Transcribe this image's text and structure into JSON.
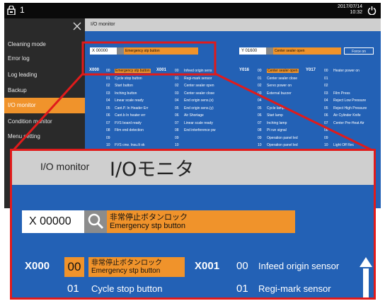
{
  "status_bar": {
    "machine_number": "1",
    "date": "2017/07/14",
    "time": "10:32"
  },
  "sidebar": {
    "items": [
      {
        "label": "Cleaning mode",
        "active": false
      },
      {
        "label": "Error log",
        "active": false
      },
      {
        "label": "Log leading",
        "active": false
      },
      {
        "label": "Backup",
        "active": false
      },
      {
        "label": "I/O monitor",
        "active": true
      },
      {
        "label": "Condition monitor",
        "active": false
      },
      {
        "label": "Menu setting",
        "active": false
      }
    ]
  },
  "io_monitor": {
    "header": "I/O monitor",
    "x_search": {
      "value": "X 00000",
      "label": "Emergency stp button"
    },
    "y_search": {
      "value": "Y 01600",
      "label": "Center sealer open",
      "force_button": "Force on"
    },
    "x_col1": {
      "address": "X000",
      "rows": [
        {
          "num": "00",
          "label": "Emergency stp button"
        },
        {
          "num": "01",
          "label": "Cycle stop button"
        },
        {
          "num": "02",
          "label": "Start button"
        },
        {
          "num": "03",
          "label": "Inching button"
        },
        {
          "num": "04",
          "label": "Linear scale ready"
        },
        {
          "num": "05",
          "label": "Cant.P. In Header Err"
        },
        {
          "num": "06",
          "label": "Cant.b In heater err"
        },
        {
          "num": "07",
          "label": "FVS board ready"
        },
        {
          "num": "08",
          "label": "Film end detection"
        },
        {
          "num": "09",
          "label": ""
        },
        {
          "num": "10",
          "label": "FVS cnw. Insu.lt ok"
        }
      ]
    },
    "x_col2": {
      "address": "X001",
      "rows": [
        {
          "num": "00",
          "label": "Infeed origin sens"
        },
        {
          "num": "01",
          "label": "Regi-mark sensor"
        },
        {
          "num": "02",
          "label": "Center sealer open"
        },
        {
          "num": "03",
          "label": "Center sealer close"
        },
        {
          "num": "04",
          "label": "End origin sens.(x)"
        },
        {
          "num": "05",
          "label": "End origin sens.(y)"
        },
        {
          "num": "06",
          "label": "Air Shortage"
        },
        {
          "num": "07",
          "label": "Linear scale ready"
        },
        {
          "num": "08",
          "label": "End interference pw"
        },
        {
          "num": "09",
          "label": ""
        },
        {
          "num": "10",
          "label": ""
        }
      ]
    },
    "y_col1": {
      "address": "Y016",
      "rows": [
        {
          "num": "00",
          "label": "Center sealer open"
        },
        {
          "num": "01",
          "label": "Center sealer close"
        },
        {
          "num": "02",
          "label": "Servo power on"
        },
        {
          "num": "03",
          "label": "External buzzer"
        },
        {
          "num": "04",
          "label": ""
        },
        {
          "num": "05",
          "label": "Cycle lamp"
        },
        {
          "num": "06",
          "label": "Start lamp"
        },
        {
          "num": "07",
          "label": "Inching lamp"
        },
        {
          "num": "08",
          "label": "Pt run signal"
        },
        {
          "num": "09",
          "label": "Operation panel led"
        },
        {
          "num": "10",
          "label": "Operation panel led"
        }
      ]
    },
    "y_col2": {
      "address": "Y017",
      "rows": [
        {
          "num": "00",
          "label": "Heater power on"
        },
        {
          "num": "01",
          "label": ""
        },
        {
          "num": "02",
          "label": ""
        },
        {
          "num": "03",
          "label": "Film Press"
        },
        {
          "num": "04",
          "label": "Reject Low Pressure"
        },
        {
          "num": "05",
          "label": "Reject High Pressure"
        },
        {
          "num": "06",
          "label": "Air Cylinder Knife"
        },
        {
          "num": "07",
          "label": "Center Pre-Heat Air"
        },
        {
          "num": "08",
          "label": ""
        },
        {
          "num": "09",
          "label": ""
        },
        {
          "num": "10",
          "label": "Light Off Rec"
        }
      ]
    }
  },
  "zoom": {
    "title_small": "I/O monitor",
    "title_big": "I/Oモニタ",
    "search_value": "X 00000",
    "search_label_jp": "非常停止ボタンロック",
    "search_label_en": "Emergency stp button",
    "row1": {
      "address": "X000",
      "num": "00",
      "label_jp": "非常停止ボタンロック",
      "label_en": "Emergency stp button",
      "address2": "X001",
      "num2": "00",
      "label2": "Infeed origin sensor"
    },
    "row2": {
      "num": "01",
      "label": "Cycle stop button",
      "num2": "01",
      "label2": "Regi-mark sensor"
    }
  },
  "colors": {
    "panel_blue": "#2361b5",
    "accent_orange": "#f0932b",
    "callout_red": "#e01b1b",
    "sidebar_dark": "#2a2a2a"
  },
  "icons": [
    "lock-icon",
    "power-icon",
    "close-icon",
    "search-icon",
    "scroll-up-icon"
  ]
}
